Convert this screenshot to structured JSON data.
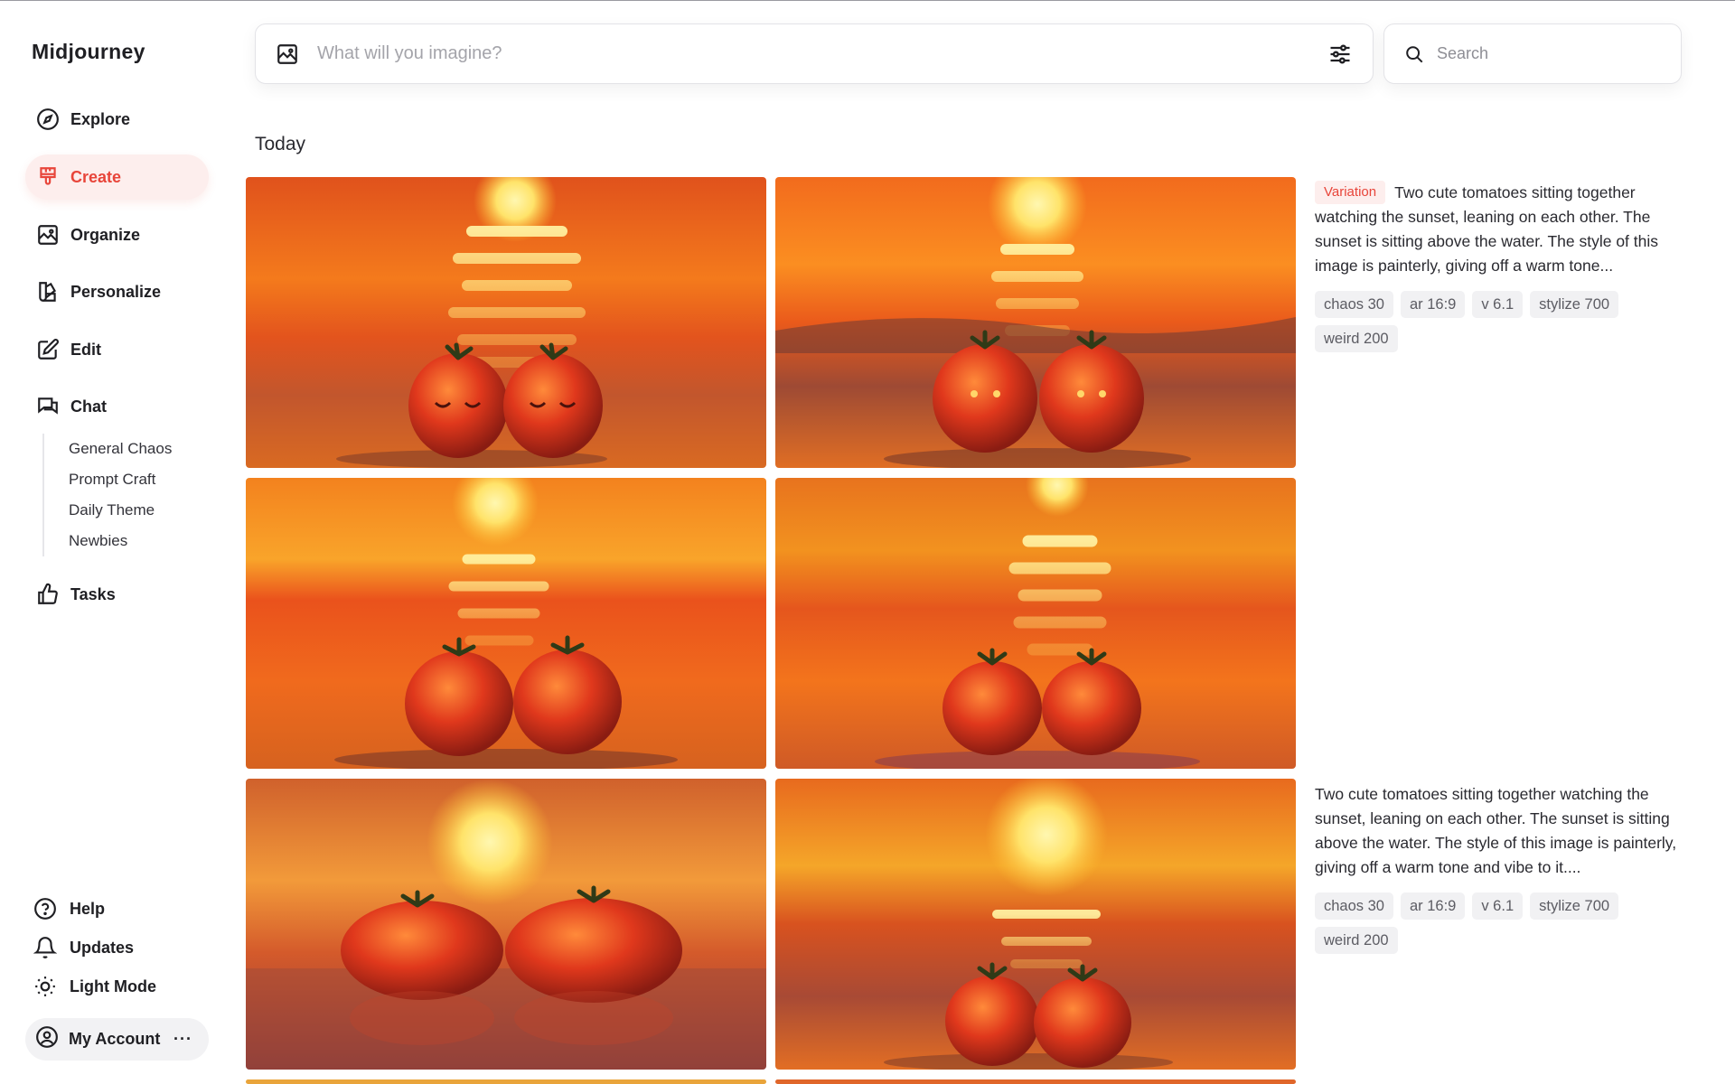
{
  "brand": "Midjourney",
  "nav": {
    "explore": "Explore",
    "create": "Create",
    "organize": "Organize",
    "personalize": "Personalize",
    "edit": "Edit",
    "chat": "Chat",
    "tasks": "Tasks"
  },
  "chat_channels": [
    "General Chaos",
    "Prompt Craft",
    "Daily Theme",
    "Newbies"
  ],
  "footer": {
    "help": "Help",
    "updates": "Updates",
    "light_mode": "Light Mode",
    "account": "My Account",
    "account_more": "···"
  },
  "prompt": {
    "placeholder": "What will you imagine?",
    "value": ""
  },
  "search": {
    "placeholder": "Search"
  },
  "section_title": "Today",
  "jobs": [
    {
      "tag": "Variation",
      "description": "Two cute tomatoes sitting together watching the sunset, leaning on each other. The sunset is sitting above the water. The style of this image is painterly, giving off a warm tone...",
      "params": [
        "chaos 30",
        "ar 16:9",
        "v 6.1",
        "stylize 700",
        "weird 200"
      ]
    },
    {
      "tag": "",
      "description": "Two cute tomatoes sitting together watching the sunset, leaning on each other. The sunset is sitting above the water. The style of this image is painterly, giving off a warm tone and vibe to it....",
      "params": [
        "chaos 30",
        "ar 16:9",
        "v 6.1",
        "stylize 700",
        "weird 200"
      ]
    }
  ],
  "colors": {
    "accent": "#e8453a",
    "accent_bg": "#fdeeed",
    "chip_bg": "#f1f1f3"
  }
}
